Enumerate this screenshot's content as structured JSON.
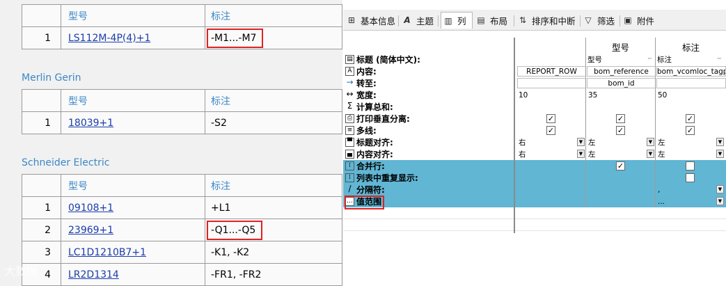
{
  "left": {
    "table1": {
      "header": {
        "model": "型号",
        "note": "标注"
      },
      "rows": [
        {
          "num": "1",
          "model": "LS112M-4P(4)+1",
          "note": "-M1...-M7"
        }
      ]
    },
    "group2": {
      "title": "Merlin Gerin",
      "header": {
        "model": "型号",
        "note": "标注"
      },
      "rows": [
        {
          "num": "1",
          "model": "18039+1",
          "note": "-S2"
        }
      ]
    },
    "group3": {
      "title": "Schneider Electric",
      "header": {
        "model": "型号",
        "note": "标注"
      },
      "rows": [
        {
          "num": "1",
          "model": "09108+1",
          "note": "+L1"
        },
        {
          "num": "2",
          "model": "23969+1",
          "note": "-Q1...-Q5"
        },
        {
          "num": "3",
          "model": "LC1D1210B7+1",
          "note": "-K1, -K2"
        },
        {
          "num": "4",
          "model": "LR2D1314",
          "note": "-FR1, -FR2"
        }
      ]
    },
    "watermark": "大数据"
  },
  "tabs": [
    {
      "label": "基本信息",
      "icon": "abc-icon"
    },
    {
      "label": "主题",
      "icon": "font-icon"
    },
    {
      "label": "列",
      "icon": "columns-icon"
    },
    {
      "label": "布局",
      "icon": "layout-icon"
    },
    {
      "label": "排序和中断",
      "icon": "sort-icon"
    },
    {
      "label": "筛选",
      "icon": "filter-icon"
    },
    {
      "label": "附件",
      "icon": "attachment-icon"
    }
  ],
  "grid": {
    "columns": [
      "",
      "型号",
      "标注"
    ],
    "rows": [
      {
        "label": "标题 (简体中文):",
        "values": [
          "",
          "型号",
          "标注"
        ]
      },
      {
        "label": "内容:",
        "values": [
          "REPORT_ROW",
          "bom_reference",
          "bom_vcomloc_tagpat"
        ]
      },
      {
        "label": "转至:",
        "values": [
          "",
          "bom_id",
          ""
        ]
      },
      {
        "label": "宽度:",
        "values": [
          "10",
          "35",
          "50"
        ]
      },
      {
        "label": "计算总和:"
      },
      {
        "label": "打印垂直分离:"
      },
      {
        "label": "多线:"
      },
      {
        "label": "标题对齐:",
        "values": [
          "右",
          "左",
          "左"
        ]
      },
      {
        "label": "内容对齐:",
        "values": [
          "右",
          "左",
          "左"
        ]
      },
      {
        "label": "合并行:"
      },
      {
        "label": "列表中重复显示:"
      },
      {
        "label": "分隔符:",
        "values": [
          "",
          "",
          ","
        ]
      },
      {
        "label": "值范围",
        "values": [
          "",
          "",
          "..."
        ]
      }
    ]
  },
  "colors": {
    "selected_row": "#61b6d4",
    "highlight": "#e02020",
    "link": "#1a3caa",
    "header_text": "#3b87c7"
  }
}
